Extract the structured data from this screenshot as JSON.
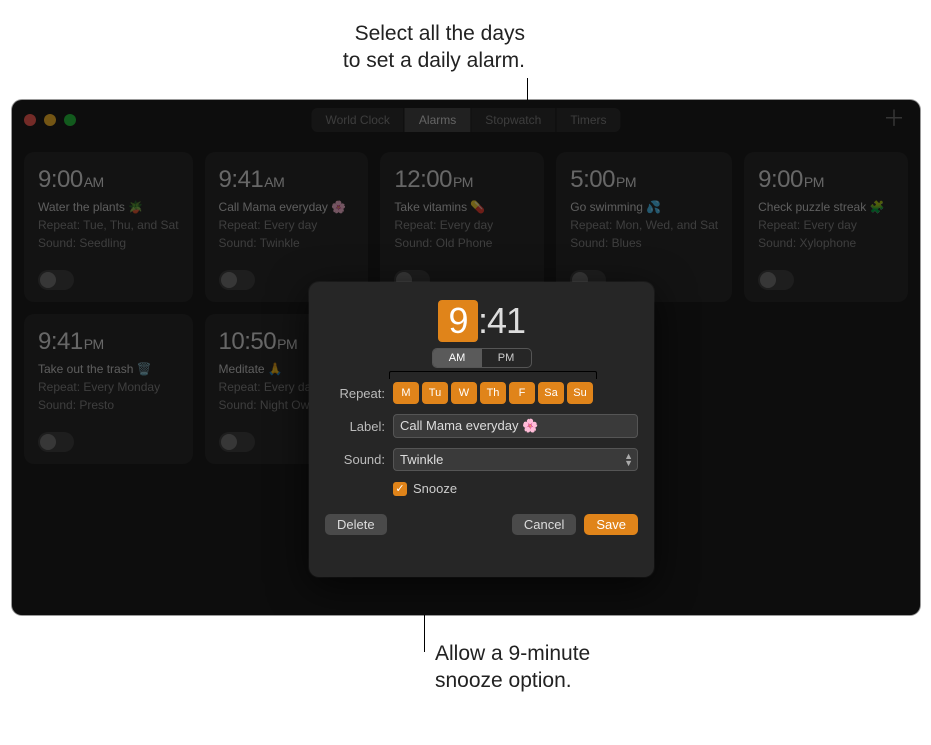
{
  "callouts": {
    "top": "Select all the days\nto set a daily alarm.",
    "bottom": "Allow a 9-minute\nsnooze option."
  },
  "tabs": [
    "World Clock",
    "Alarms",
    "Stopwatch",
    "Timers"
  ],
  "active_tab": "Alarms",
  "alarms": [
    {
      "time": "9:00",
      "ampm": "AM",
      "title": "Water the plants 🪴",
      "repeat": "Repeat: Tue, Thu, and Sat",
      "sound": "Sound: Seedling"
    },
    {
      "time": "9:41",
      "ampm": "AM",
      "title": "Call Mama everyday 🌸",
      "repeat": "Repeat: Every day",
      "sound": "Sound: Twinkle"
    },
    {
      "time": "12:00",
      "ampm": "PM",
      "title": "Take vitamins 💊",
      "repeat": "Repeat: Every day",
      "sound": "Sound: Old Phone"
    },
    {
      "time": "5:00",
      "ampm": "PM",
      "title": "Go swimming 💦",
      "repeat": "Repeat: Mon, Wed, and Sat",
      "sound": "Sound: Blues"
    },
    {
      "time": "9:00",
      "ampm": "PM",
      "title": "Check puzzle streak 🧩",
      "repeat": "Repeat: Every day",
      "sound": "Sound: Xylophone"
    },
    {
      "time": "9:41",
      "ampm": "PM",
      "title": "Take out the trash 🗑️",
      "repeat": "Repeat: Every Monday",
      "sound": "Sound: Presto"
    },
    {
      "time": "10:50",
      "ampm": "PM",
      "title": "Meditate 🙏",
      "repeat": "Repeat: Every day",
      "sound": "Sound: Night Owl"
    }
  ],
  "edit": {
    "hour": "9",
    "minute": "41",
    "ampm_options": [
      "AM",
      "PM"
    ],
    "ampm_selected": "AM",
    "repeat_label": "Repeat:",
    "days": [
      "M",
      "Tu",
      "W",
      "Th",
      "F",
      "Sa",
      "Su"
    ],
    "label_label": "Label:",
    "label_value": "Call Mama everyday 🌸",
    "sound_label": "Sound:",
    "sound_value": "Twinkle",
    "snooze_label": "Snooze",
    "delete": "Delete",
    "cancel": "Cancel",
    "save": "Save"
  }
}
